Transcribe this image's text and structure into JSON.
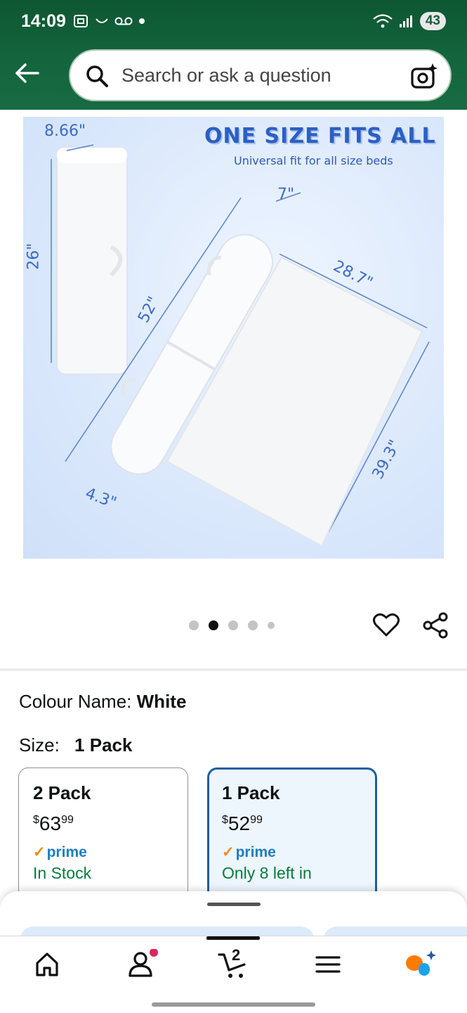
{
  "status_bar": {
    "time": "14:09",
    "battery": "43"
  },
  "search": {
    "placeholder": "Search or ask a question"
  },
  "hero": {
    "title": "ONE SIZE FITS ALL",
    "subtitle": "Universal fit for all size beds",
    "dims": {
      "w1": "8.66\"",
      "h1": "26\"",
      "d1": "7\"",
      "len": "52\"",
      "w2": "28.7\"",
      "h2": "39.3\"",
      "dia": "4.3\""
    }
  },
  "carousel": {
    "count": 5,
    "active_index": 1
  },
  "colour": {
    "label": "Colour Name:",
    "value": "White"
  },
  "size": {
    "label": "Size:",
    "value": "1 Pack"
  },
  "options": [
    {
      "title": "2 Pack",
      "currency": "$",
      "price_whole": "63",
      "price_fraction": "99",
      "prime": "prime",
      "stock": "In Stock"
    },
    {
      "title": "1 Pack",
      "currency": "$",
      "price_whole": "52",
      "price_fraction": "99",
      "prime": "prime",
      "stock": "Only 8 left in"
    }
  ],
  "nav": {
    "cart_count": "2"
  },
  "colors": {
    "header": "#14653d",
    "accent_blue": "#1e5ea0",
    "in_stock": "#067d3c",
    "prime_check": "#f08b17",
    "notify_dot": "#e0245e"
  }
}
